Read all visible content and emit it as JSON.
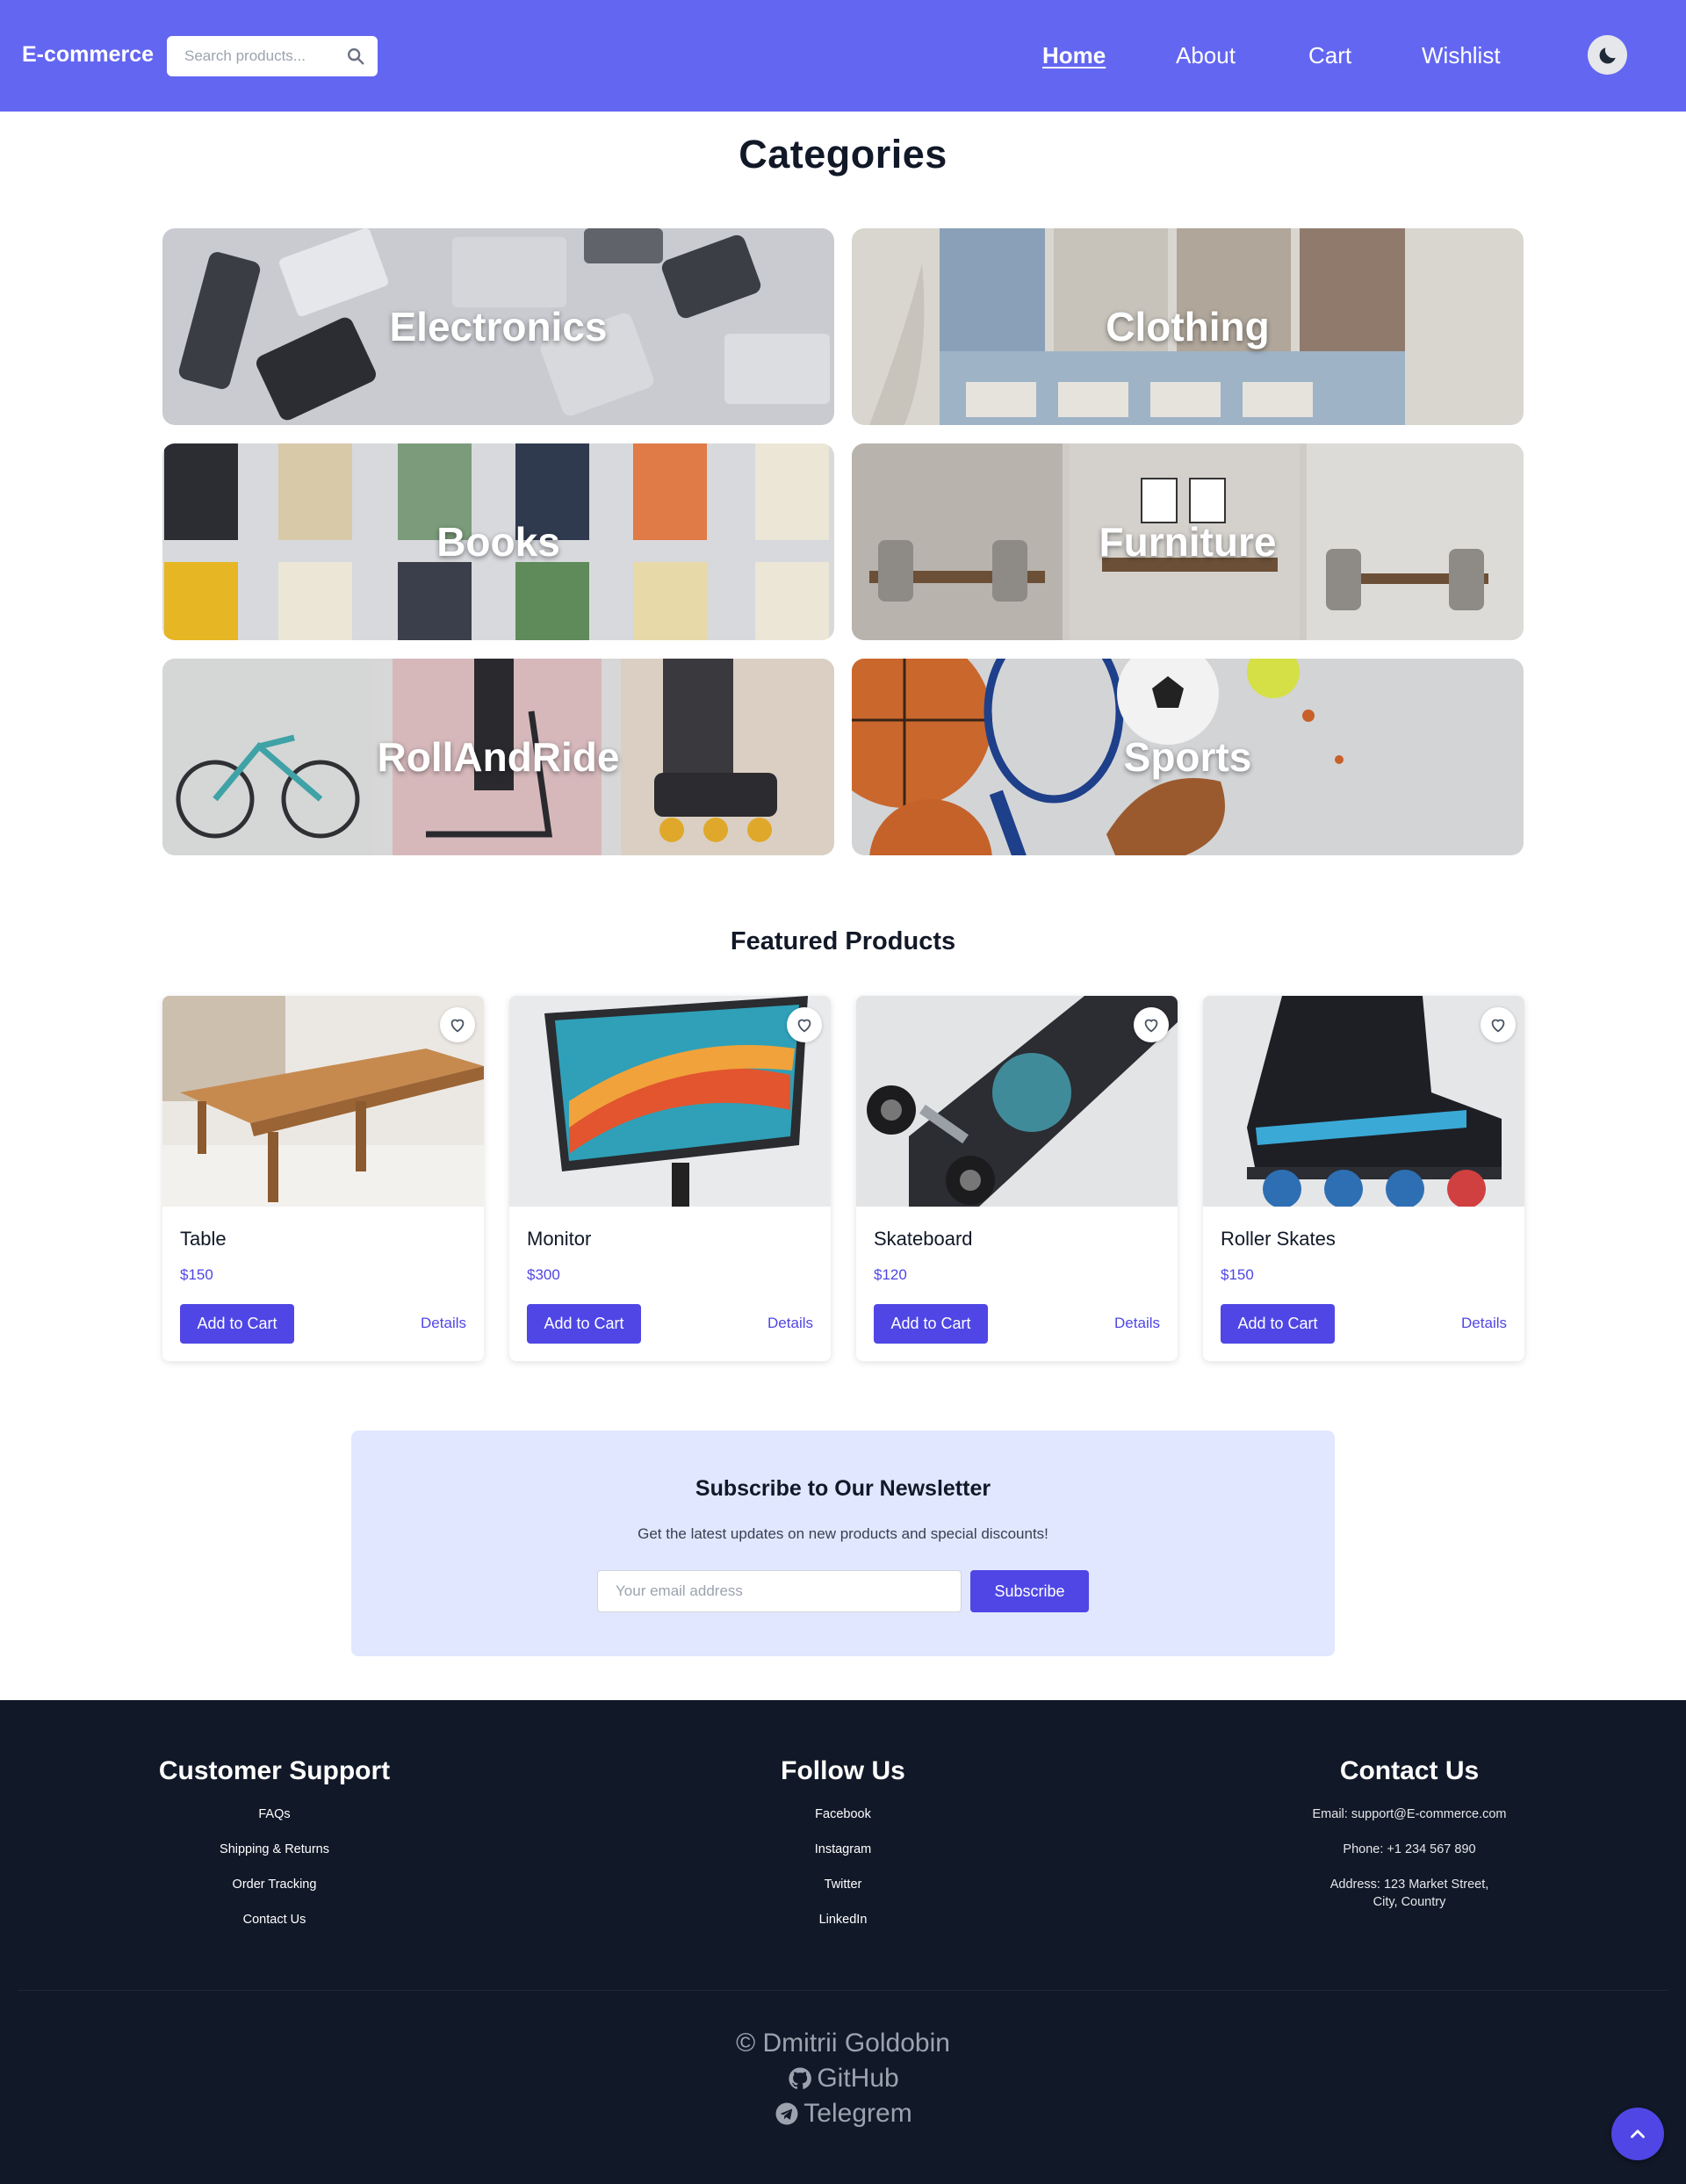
{
  "nav": {
    "brand": "E-commerce",
    "search_placeholder": "Search products...",
    "links": [
      "Home",
      "About",
      "Cart",
      "Wishlist"
    ],
    "active_link": "Home"
  },
  "categories": {
    "title": "Categories",
    "items": [
      "Electronics",
      "Clothing",
      "Books",
      "Furniture",
      "RollAndRide",
      "Sports"
    ]
  },
  "featured": {
    "title": "Featured Products",
    "products": [
      {
        "name": "Table",
        "price": "$150",
        "add_label": "Add to Cart",
        "details_label": "Details"
      },
      {
        "name": "Monitor",
        "price": "$300",
        "add_label": "Add to Cart",
        "details_label": "Details"
      },
      {
        "name": "Skateboard",
        "price": "$120",
        "add_label": "Add to Cart",
        "details_label": "Details"
      },
      {
        "name": "Roller Skates",
        "price": "$150",
        "add_label": "Add to Cart",
        "details_label": "Details"
      }
    ]
  },
  "newsletter": {
    "title": "Subscribe to Our Newsletter",
    "subtitle": "Get the latest updates on new products and special discounts!",
    "email_placeholder": "Your email address",
    "button_label": "Subscribe"
  },
  "footer": {
    "support": {
      "title": "Customer Support",
      "items": [
        "FAQs",
        "Shipping & Returns",
        "Order Tracking",
        "Contact Us"
      ]
    },
    "follow": {
      "title": "Follow Us",
      "items": [
        "Facebook",
        "Instagram",
        "Twitter",
        "LinkedIn"
      ]
    },
    "contact": {
      "title": "Contact Us",
      "email": "Email: support@E-commerce.com",
      "phone": "Phone: +1 234 567 890",
      "address_line1": "Address: 123 Market Street,",
      "address_line2": "City, Country"
    },
    "copyright": "© Dmitrii Goldobin",
    "github": "GitHub",
    "telegram": "Telegrem"
  },
  "colors": {
    "navbar": "#6366f1",
    "accent": "#4f46e5",
    "newsletter_bg": "#e0e7ff",
    "footer_bg": "#111827"
  }
}
